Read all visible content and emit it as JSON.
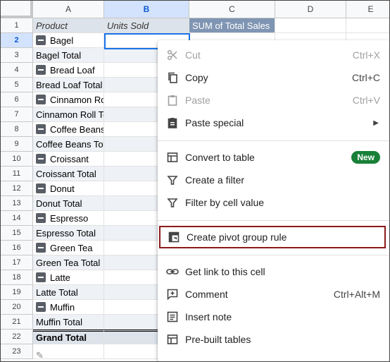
{
  "columns": [
    "A",
    "B",
    "C",
    "D",
    "E"
  ],
  "selected_column": "B",
  "selected_row": 2,
  "rows": [
    {
      "num": "1",
      "a": "Product",
      "b": "Units Sold",
      "c": "SUM of Total Sales",
      "kind": "header"
    },
    {
      "num": "2",
      "a": "Bagel",
      "kind": "group"
    },
    {
      "num": "3",
      "a": "Bagel Total",
      "kind": "total"
    },
    {
      "num": "4",
      "a": "Bread Loaf",
      "kind": "group"
    },
    {
      "num": "5",
      "a": "Bread Loaf Total",
      "kind": "total"
    },
    {
      "num": "6",
      "a": "Cinnamon Ro",
      "kind": "group"
    },
    {
      "num": "7",
      "a": "Cinnamon Roll Total",
      "kind": "total"
    },
    {
      "num": "8",
      "a": "Coffee Beans",
      "kind": "group"
    },
    {
      "num": "9",
      "a": "Coffee Beans Total",
      "kind": "total"
    },
    {
      "num": "10",
      "a": "Croissant",
      "kind": "group"
    },
    {
      "num": "11",
      "a": "Croissant Total",
      "kind": "total"
    },
    {
      "num": "12",
      "a": "Donut",
      "kind": "group"
    },
    {
      "num": "13",
      "a": "Donut Total",
      "kind": "total"
    },
    {
      "num": "14",
      "a": "Espresso",
      "kind": "group"
    },
    {
      "num": "15",
      "a": "Espresso Total",
      "kind": "total"
    },
    {
      "num": "16",
      "a": "Green Tea",
      "kind": "group"
    },
    {
      "num": "17",
      "a": "Green Tea Total",
      "kind": "total"
    },
    {
      "num": "18",
      "a": "Latte",
      "kind": "group"
    },
    {
      "num": "19",
      "a": "Latte Total",
      "kind": "total"
    },
    {
      "num": "20",
      "a": "Muffin",
      "kind": "group"
    },
    {
      "num": "21",
      "a": "Muffin Total",
      "kind": "total"
    },
    {
      "num": "22",
      "a": "Grand Total",
      "kind": "grand"
    },
    {
      "num": "23",
      "a": "",
      "kind": "empty"
    }
  ],
  "menu": {
    "cut": {
      "label": "Cut",
      "shortcut": "Ctrl+X"
    },
    "copy": {
      "label": "Copy",
      "shortcut": "Ctrl+C"
    },
    "paste": {
      "label": "Paste",
      "shortcut": "Ctrl+V"
    },
    "paste_special": {
      "label": "Paste special"
    },
    "convert_to_table": {
      "label": "Convert to table",
      "badge": "New"
    },
    "create_filter": {
      "label": "Create a filter"
    },
    "filter_by_value": {
      "label": "Filter by cell value"
    },
    "create_pivot_group_rule": {
      "label": "Create pivot group rule"
    },
    "get_link": {
      "label": "Get link to this cell"
    },
    "comment": {
      "label": "Comment",
      "shortcut": "Ctrl+Alt+M"
    },
    "insert_note": {
      "label": "Insert note"
    },
    "prebuilt_tables": {
      "label": "Pre-built tables"
    }
  }
}
